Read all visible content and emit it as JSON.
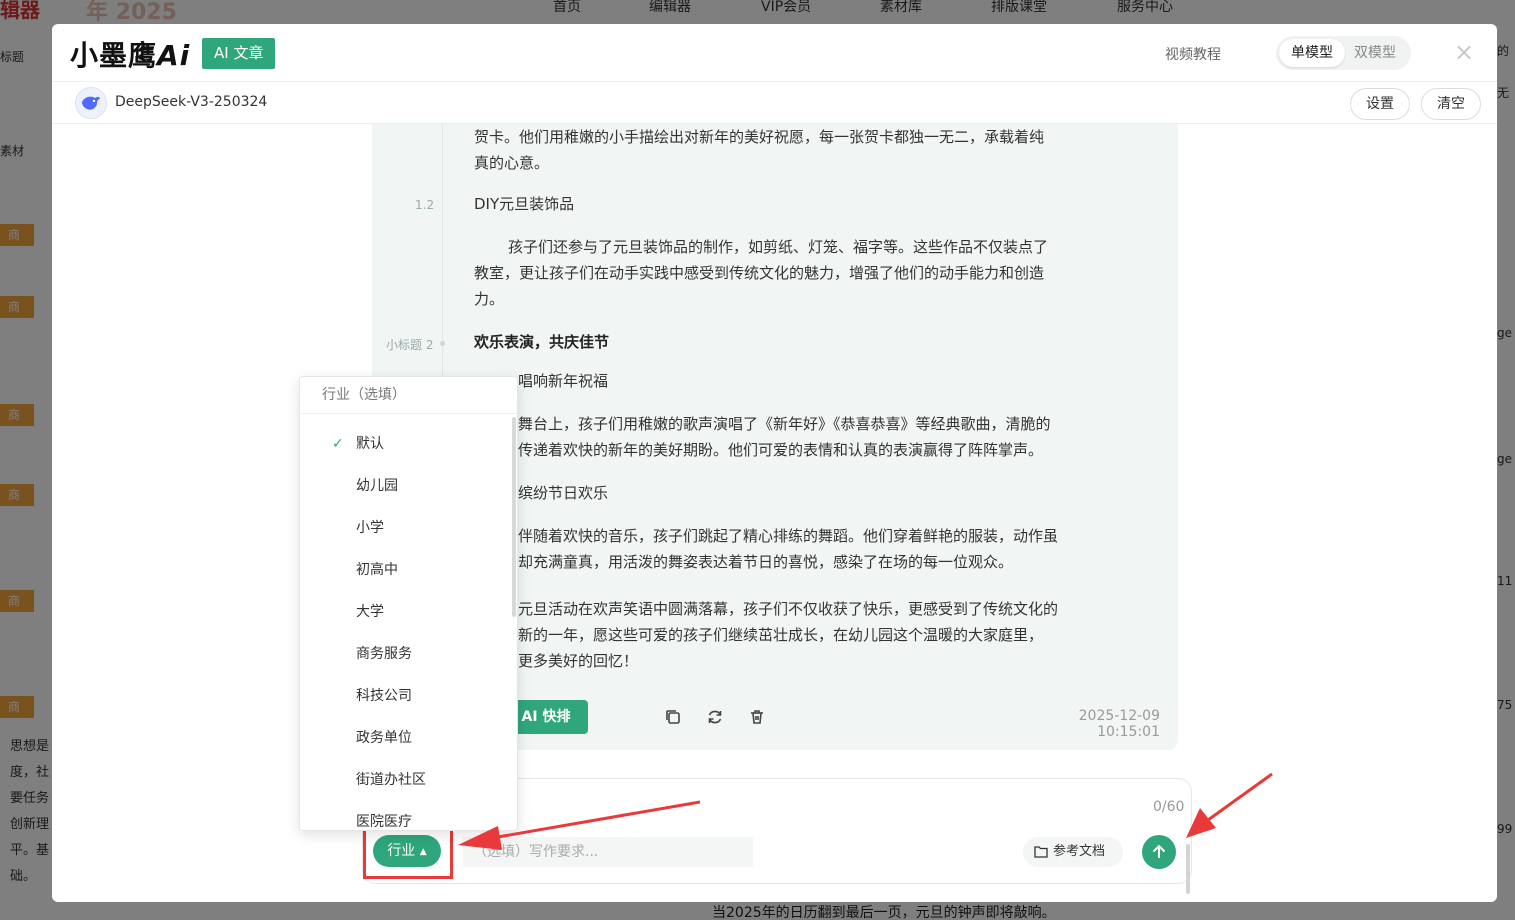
{
  "background": {
    "logo_partial": "辑器",
    "year_partial": "年 2025",
    "nav": [
      "首页",
      "编辑器",
      "VIP会员",
      "素材库",
      "排版课堂",
      "服务中心"
    ],
    "left_text_title": "标题",
    "left_text_material": "素材",
    "left_badge": "商",
    "left_paragraph": [
      "思想是",
      "度，社",
      "要任务",
      "创新理",
      "平。基",
      "础。"
    ],
    "right_text": [
      "的",
      "无",
      "ge",
      "ge",
      "11",
      "75",
      "99"
    ],
    "bottom_text": "当2025年的日历翻到最后一页，元旦的钟声即将敲响。"
  },
  "header": {
    "brand_text": "小墨鹰",
    "brand_ai": "Ai",
    "brand_tag": "AI 文章",
    "video_tutorial": "视频教程",
    "mode_single": "单模型",
    "mode_dual": "双模型",
    "close_symbol": "×"
  },
  "model_bar": {
    "model_name": "DeepSeek-V3-250324",
    "settings_label": "设置",
    "clear_label": "清空"
  },
  "article": {
    "intro_para": [
      "贺卡。他们用稚嫩的小手描绘出对新年的美好祝愿，每一张贺卡都独一无二，承载着纯",
      "真的心意。"
    ],
    "section_1_2_num": "1.2",
    "section_1_2_title": "DIY元旦装饰品",
    "section_1_2_para": [
      "孩子们还参与了元旦装饰品的制作，如剪纸、灯笼、福字等。这些作品不仅装点了",
      "教室，更让孩子们在动手实践中感受到传统文化的魅力，增强了他们的动手能力和创造",
      "力。"
    ],
    "subtitle_2_num": "小标题 2",
    "subtitle_2_title": "欢乐表演，共庆佳节",
    "section_2_1_title": "唱响新年祝福",
    "section_2_1_para": [
      "舞台上，孩子们用稚嫩的歌声演唱了《新年好》《恭喜恭喜》等经典歌曲，清脆的",
      "传递着欢快的新年的美好期盼。他们可爱的表情和认真的表演赢得了阵阵掌声。"
    ],
    "section_2_2_title": "缤纷节日欢乐",
    "section_2_2_para": [
      "伴随着欢快的音乐，孩子们跳起了精心排练的舞蹈。他们穿着鲜艳的服装，动作虽",
      "却充满童真，用活泼的舞姿表达着节日的喜悦，感染了在场的每一位观众。"
    ],
    "closing_para": [
      "元旦活动在欢声笑语中圆满落幕，孩子们不仅收获了快乐，更感受到了传统文化的",
      "新的一年，愿这些可爱的孩子们继续茁壮成长，在幼儿园这个温暖的大家庭里，",
      "更多美好的回忆！"
    ],
    "ai_button": "AI 快排",
    "timestamp": "2025-12-09 10:15:01"
  },
  "input": {
    "counter": "0/60",
    "industry_label": "行业",
    "placeholder": "（选填）写作要求...",
    "reference_doc": "参考文档"
  },
  "dropdown": {
    "header": "行业（选填）",
    "selected_index": 0,
    "items": [
      "默认",
      "幼儿园",
      "小学",
      "初高中",
      "大学",
      "商务服务",
      "科技公司",
      "政务单位",
      "街道办社区",
      "医院医疗"
    ]
  },
  "colors": {
    "accent": "#2fa67b",
    "highlight_red": "#e83a3a",
    "card_bg": "#f1f5f4"
  }
}
